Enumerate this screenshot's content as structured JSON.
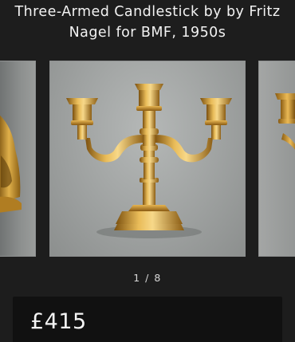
{
  "product": {
    "title": "Three-Armed Candlestick by by Fritz\nNagel for BMF, 1950s",
    "price": "£415"
  },
  "gallery": {
    "counter": "1 / 8",
    "current_index": 1,
    "total": 8
  },
  "colors": {
    "background": "#1d1d1d",
    "price_card": "#111111",
    "brass": "#c9932f"
  }
}
